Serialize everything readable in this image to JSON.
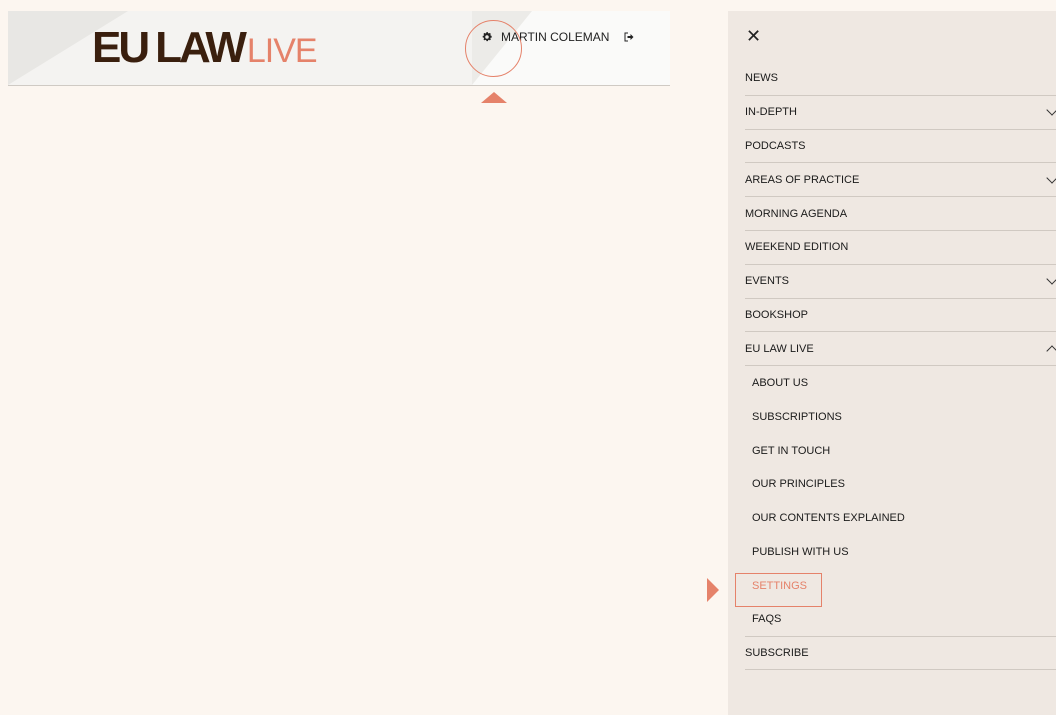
{
  "header": {
    "logo": {
      "eu": "EU",
      "law": "LAW",
      "live": "LIVE"
    },
    "user_name": "MARTIN COLEMAN",
    "icons": {
      "settings": "gear-icon",
      "logout": "logout-icon"
    }
  },
  "panel": {
    "close_label": "✕",
    "menu": [
      {
        "label": "NEWS",
        "chevron": ""
      },
      {
        "label": "IN-DEPTH",
        "chevron": "down"
      },
      {
        "label": "PODCASTS",
        "chevron": ""
      },
      {
        "label": "AREAS OF PRACTICE",
        "chevron": "down"
      },
      {
        "label": "MORNING AGENDA",
        "chevron": ""
      },
      {
        "label": "WEEKEND EDITION",
        "chevron": ""
      },
      {
        "label": "EVENTS",
        "chevron": "down"
      },
      {
        "label": "BOOKSHOP",
        "chevron": ""
      },
      {
        "label": "EU LAW LIVE",
        "chevron": "up"
      }
    ],
    "submenu": [
      {
        "label": "ABOUT US"
      },
      {
        "label": "SUBSCRIPTIONS"
      },
      {
        "label": "GET IN TOUCH"
      },
      {
        "label": "OUR PRINCIPLES"
      },
      {
        "label": "OUR CONTENTS EXPLAINED"
      },
      {
        "label": "PUBLISH WITH US"
      },
      {
        "label": "SETTINGS",
        "active": true
      },
      {
        "label": "FAQS"
      }
    ],
    "after": [
      {
        "label": "SUBSCRIBE"
      }
    ]
  },
  "colors": {
    "accent": "#e5826a",
    "logo_dark": "#3a1f0e",
    "background": "#fcf6f0",
    "panel": "#efe8e2"
  }
}
